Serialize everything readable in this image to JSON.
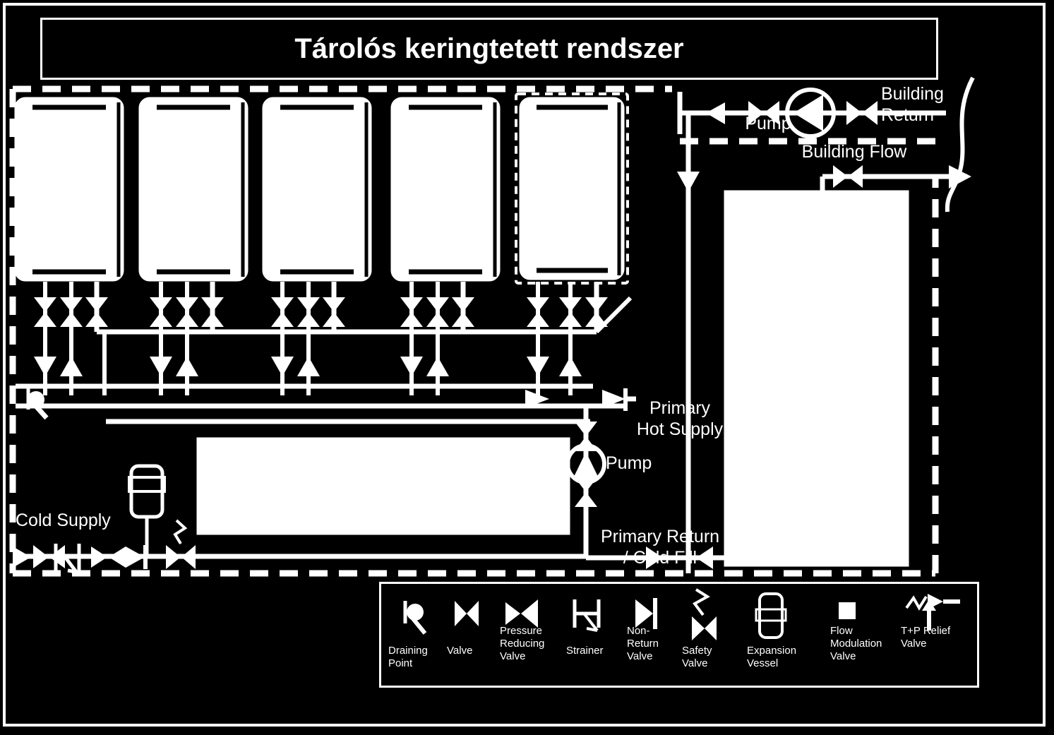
{
  "title": "Tárolós keringtetett rendszer",
  "labels": {
    "building_return": "Building\nReturn",
    "building_flow": "Building Flow",
    "pump_top": "Pump",
    "pump_primary": "Pump",
    "primary_hot_supply": "Primary\nHot Supply",
    "primary_return": "Primary Return\n/ Cold Fill",
    "cold_supply": "Cold Supply"
  },
  "legend": {
    "items": [
      {
        "icon": "draining-point-icon",
        "label": "Draining\nPoint"
      },
      {
        "icon": "valve-icon",
        "label": "Valve"
      },
      {
        "icon": "pressure-reducing-valve-icon",
        "label": "Pressure\nReducing\nValve"
      },
      {
        "icon": "strainer-icon",
        "label": "Strainer"
      },
      {
        "icon": "non-return-valve-icon",
        "label": "Non-\nReturn\nValve"
      },
      {
        "icon": "safety-valve-icon",
        "label": "Safety\nValve"
      },
      {
        "icon": "expansion-vessel-icon",
        "label": "Expansion\nVessel"
      },
      {
        "icon": "flow-modulation-valve-icon",
        "label": "Flow\nModulation\nValve"
      },
      {
        "icon": "tp-relief-valve-icon",
        "label": "T+P Relief\nValve"
      }
    ]
  },
  "colors": {
    "background": "#000000",
    "stroke": "#ffffff",
    "fill": "#ffffff"
  },
  "components": {
    "water_heaters_count": 5,
    "water_heater_standby_index": 5,
    "storage_tank": "storage-tank",
    "secondary_vessel": "secondary-tank"
  }
}
